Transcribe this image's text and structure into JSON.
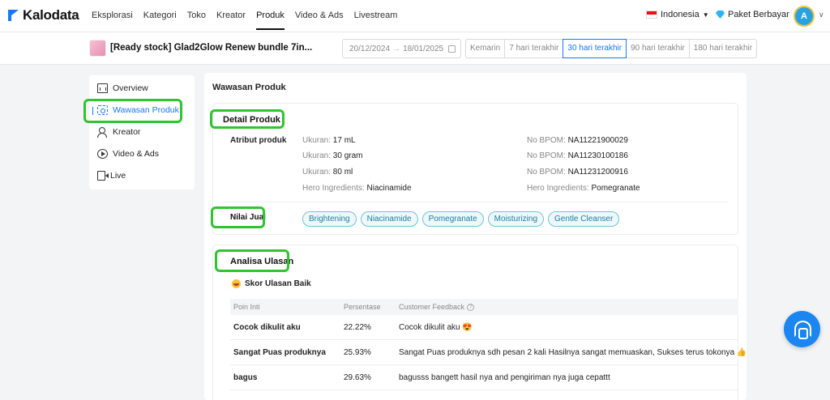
{
  "app": {
    "logo_text": "Kalodata"
  },
  "nav": [
    {
      "label": "Eksplorasi"
    },
    {
      "label": "Kategori"
    },
    {
      "label": "Toko"
    },
    {
      "label": "Kreator"
    },
    {
      "label": "Produk",
      "active": true
    },
    {
      "label": "Video & Ads"
    },
    {
      "label": "Livestream"
    }
  ],
  "header": {
    "language": "Indonesia",
    "plan": "Paket Berbayar",
    "avatar_letter": "A"
  },
  "product": {
    "title": "[Ready stock] Glad2Glow Renew bundle 7in...",
    "date_start": "20/12/2024",
    "date_arrow": "→",
    "date_end": "18/01/2025",
    "periods": [
      "Kemarin",
      "7 hari terakhir",
      "30 hari terakhir",
      "90 hari terakhir",
      "180 hari terakhir"
    ],
    "active_period": "30 hari terakhir"
  },
  "sidebar": {
    "items": [
      {
        "label": "Overview"
      },
      {
        "label": "Wawasan Produk"
      },
      {
        "label": "Kreator"
      },
      {
        "label": "Video & Ads"
      },
      {
        "label": "Live"
      }
    ],
    "active": "Wawasan Produk"
  },
  "main": {
    "title": "Wawasan Produk",
    "detail": {
      "heading": "Detail Produk",
      "attr_label": "Atribut produk",
      "left": [
        {
          "key": "Ukuran: ",
          "value": "17 mL"
        },
        {
          "key": "Ukuran: ",
          "value": "30 gram"
        },
        {
          "key": "Ukuran: ",
          "value": "80 ml"
        },
        {
          "key": "Hero Ingredients: ",
          "value": "Niacinamide"
        }
      ],
      "right": [
        {
          "key": "No BPOM: ",
          "value": "NA11221900029"
        },
        {
          "key": "No BPOM: ",
          "value": "NA11230100186"
        },
        {
          "key": "No BPOM: ",
          "value": "NA11231200916"
        },
        {
          "key": "Hero Ingredients: ",
          "value": "Pomegranate"
        }
      ],
      "value_label": "Nilai Jual",
      "tags": [
        "Brightening",
        "Niacinamide",
        "Pomegranate",
        "Moisturizing",
        "Gentle Cleanser"
      ]
    },
    "reviews": {
      "heading": "Analisa Ulasan",
      "score_label": "Skor Ulasan Baik",
      "columns": [
        "Poin Inti",
        "Persentase",
        "Customer Feedback"
      ],
      "rows": [
        {
          "point": "Cocok dikulit aku",
          "pct": "22.22%",
          "feedback": "Cocok dikulit aku 😍"
        },
        {
          "point": "Sangat Puas produknya",
          "pct": "25.93%",
          "feedback": "Sangat Puas produknya sdh pesan 2 kali Hasilnya sangat memuaskan, Sukses terus tokonya 👍"
        },
        {
          "point": "bagus",
          "pct": "29.63%",
          "feedback": "bagusss bangett hasil nya and pengiriman nya juga cepattt"
        }
      ]
    }
  },
  "colors": {
    "accent": "#1677ff",
    "highlight": "#2fc52f",
    "tag_border": "#6cc3d8"
  }
}
